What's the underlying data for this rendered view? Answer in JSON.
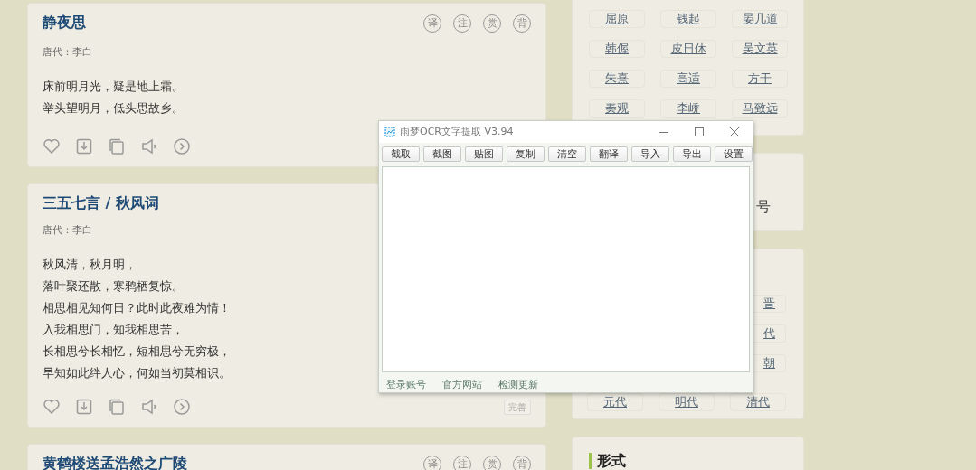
{
  "poems": [
    {
      "title": "静夜思",
      "meta": "唐代：李白",
      "tools": [
        "译",
        "注",
        "赏",
        "背"
      ],
      "lines": [
        "床前明月光，疑是地上霜。",
        "举头望明月，低头思故乡。"
      ],
      "actions": true
    },
    {
      "title": "三五七言 / 秋风词",
      "meta": "唐代：李白",
      "lines": [
        "秋风清，秋月明，",
        "落叶聚还散，寒鸦栖复惊。",
        "相思相见知何日？此时此夜难为情！",
        "入我相思门，知我相思苦，",
        "长相思兮长相忆，短相思兮无穷极，",
        "早知如此绊人心，何如当初莫相识。"
      ],
      "actions": true,
      "fix_button": "完善"
    },
    {
      "title": "黄鹤楼送孟浩然之广陵",
      "tools": [
        "译",
        "注",
        "赏",
        "背"
      ]
    }
  ],
  "authors": {
    "tags": [
      "屈原",
      "钱起",
      "晏几道",
      "韩偓",
      "皮日休",
      "吴文英",
      "朱熹",
      "高适",
      "方干",
      "秦观",
      "李峤",
      "马致远"
    ]
  },
  "account_card": {
    "text": "号"
  },
  "dynasties": {
    "rows": [
      [
        {
          "label": "晋",
          "kind": "cut"
        }
      ],
      [
        {
          "label": "代",
          "kind": "cut"
        }
      ],
      [
        {
          "label": "朝",
          "kind": "cut"
        }
      ],
      [
        {
          "label": "元代",
          "kind": "full"
        },
        {
          "label": "明代",
          "kind": "full"
        },
        {
          "label": "清代",
          "kind": "full"
        }
      ]
    ]
  },
  "forms": {
    "title": "形式"
  },
  "ocr_window": {
    "title": "雨梦OCR文字提取 V3.94",
    "toolbar": [
      "截取",
      "截图",
      "贴图",
      "复制",
      "清空",
      "翻译",
      "导入",
      "导出",
      "设置"
    ],
    "footer_links": [
      "登录账号",
      "官方网站",
      "检测更新"
    ]
  }
}
